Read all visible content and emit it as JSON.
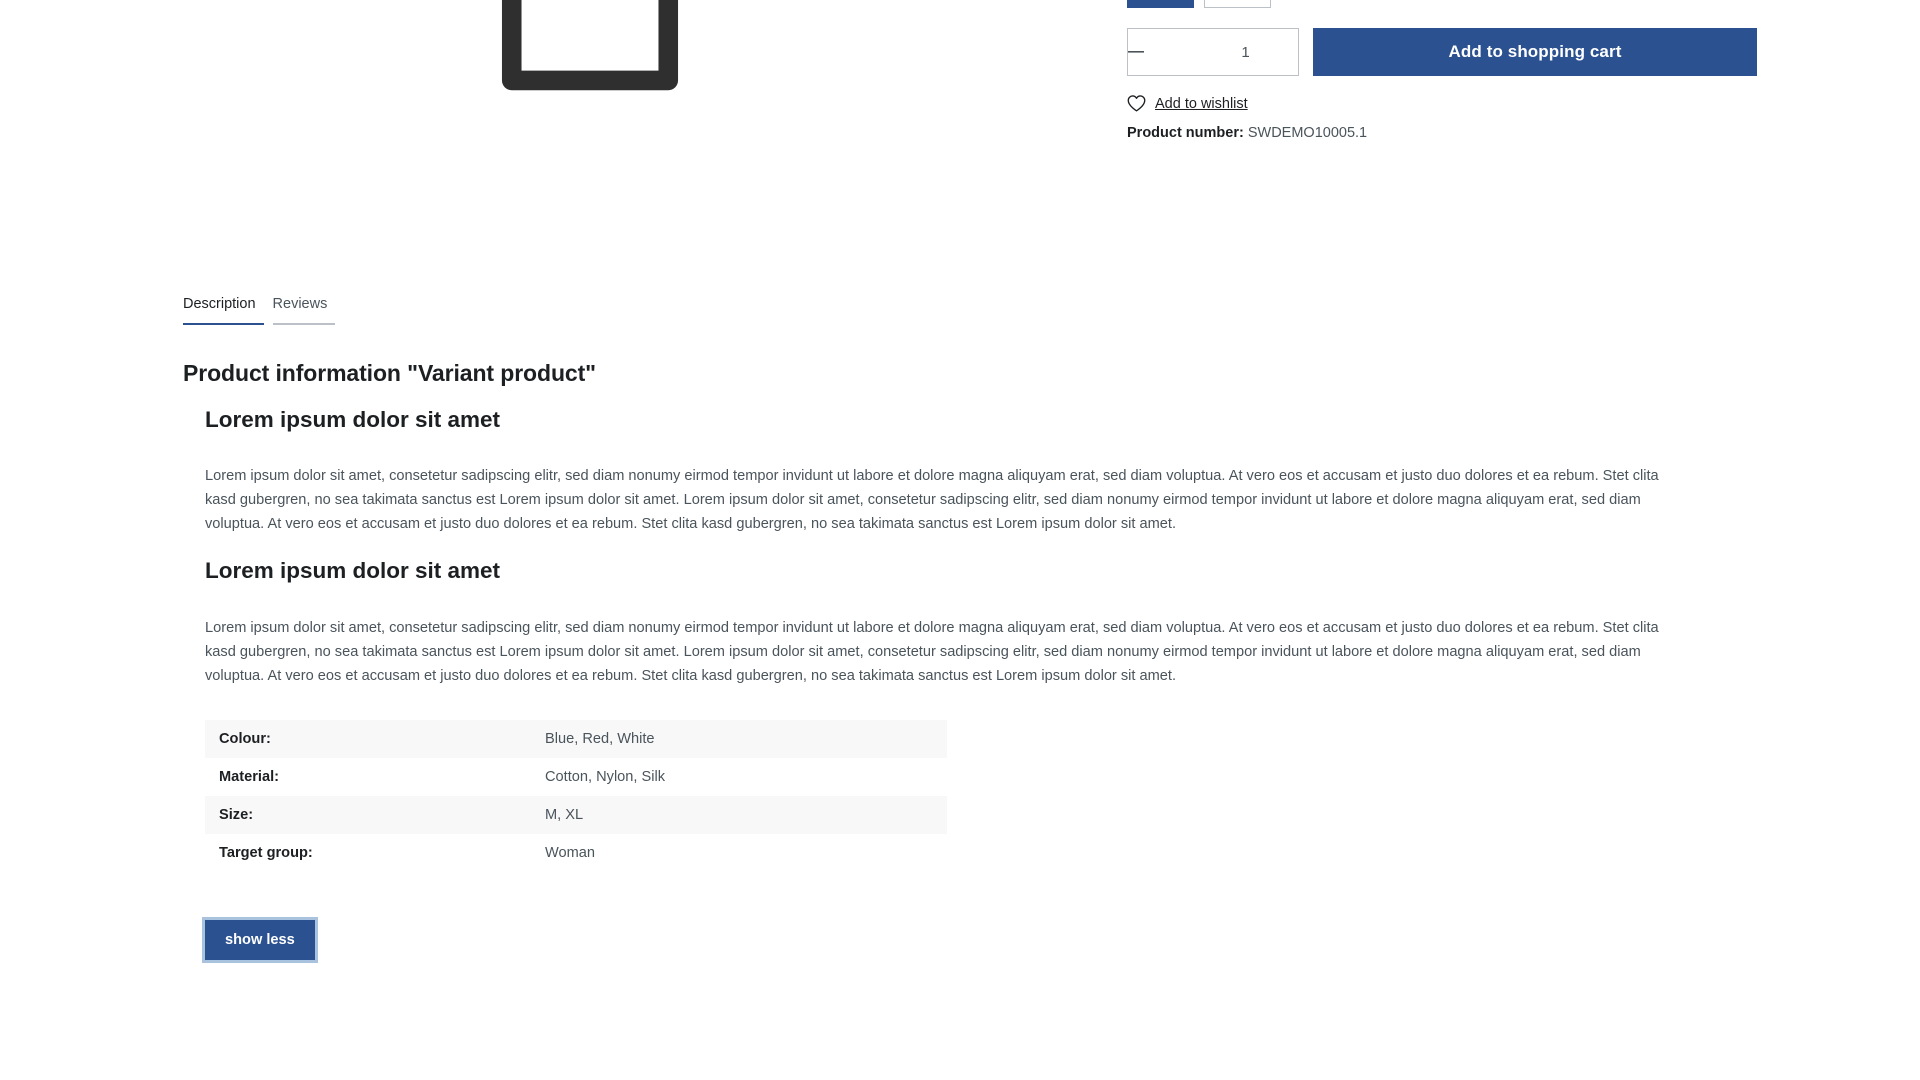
{
  "gallery": {
    "placeholder_icon": "tshirt-placeholder-icon"
  },
  "buy_widget": {
    "variants": [
      {
        "label": "",
        "selected": true
      },
      {
        "label": "",
        "selected": false
      }
    ],
    "quantity": {
      "decrease_icon": "minus-icon",
      "increase_icon": "plus-icon",
      "value": "1"
    },
    "add_to_cart_label": "Add to shopping cart",
    "wishlist": {
      "icon": "heart-icon",
      "label": "Add to wishlist"
    },
    "product_number": {
      "label": "Product number:",
      "value": "SWDEMO10005.1"
    },
    "accent_color": "#2b5191"
  },
  "tabs": [
    {
      "label": "Description",
      "active": true
    },
    {
      "label": "Reviews",
      "active": false
    }
  ],
  "description": {
    "title": "Product information \"Variant product\"",
    "heading_1": "Lorem ipsum dolor sit amet",
    "paragraph_1": "Lorem ipsum dolor sit amet, consetetur sadipscing elitr, sed diam nonumy eirmod tempor invidunt ut labore et dolore magna aliquyam erat, sed diam voluptua. At vero eos et accusam et justo duo dolores et ea rebum. Stet clita kasd gubergren, no sea takimata sanctus est Lorem ipsum dolor sit amet. Lorem ipsum dolor sit amet, consetetur sadipscing elitr, sed diam nonumy eirmod tempor invidunt ut labore et dolore magna aliquyam erat, sed diam voluptua. At vero eos et accusam et justo duo dolores et ea rebum. Stet clita kasd gubergren, no sea takimata sanctus est Lorem ipsum dolor sit amet.",
    "heading_2": "Lorem ipsum dolor sit amet",
    "paragraph_2": "Lorem ipsum dolor sit amet, consetetur sadipscing elitr, sed diam nonumy eirmod tempor invidunt ut labore et dolore magna aliquyam erat, sed diam voluptua. At vero eos et accusam et justo duo dolores et ea rebum. Stet clita kasd gubergren, no sea takimata sanctus est Lorem ipsum dolor sit amet. Lorem ipsum dolor sit amet, consetetur sadipscing elitr, sed diam nonumy eirmod tempor invidunt ut labore et dolore magna aliquyam erat, sed diam voluptua. At vero eos et accusam et justo duo dolores et ea rebum. Stet clita kasd gubergren, no sea takimata sanctus est Lorem ipsum dolor sit amet."
  },
  "properties": [
    {
      "label": "Colour:",
      "value": "Blue, Red, White"
    },
    {
      "label": "Material:",
      "value": "Cotton, Nylon, Silk"
    },
    {
      "label": "Size:",
      "value": "M, XL"
    },
    {
      "label": "Target group:",
      "value": "Woman"
    }
  ],
  "show_less_label": "show less"
}
